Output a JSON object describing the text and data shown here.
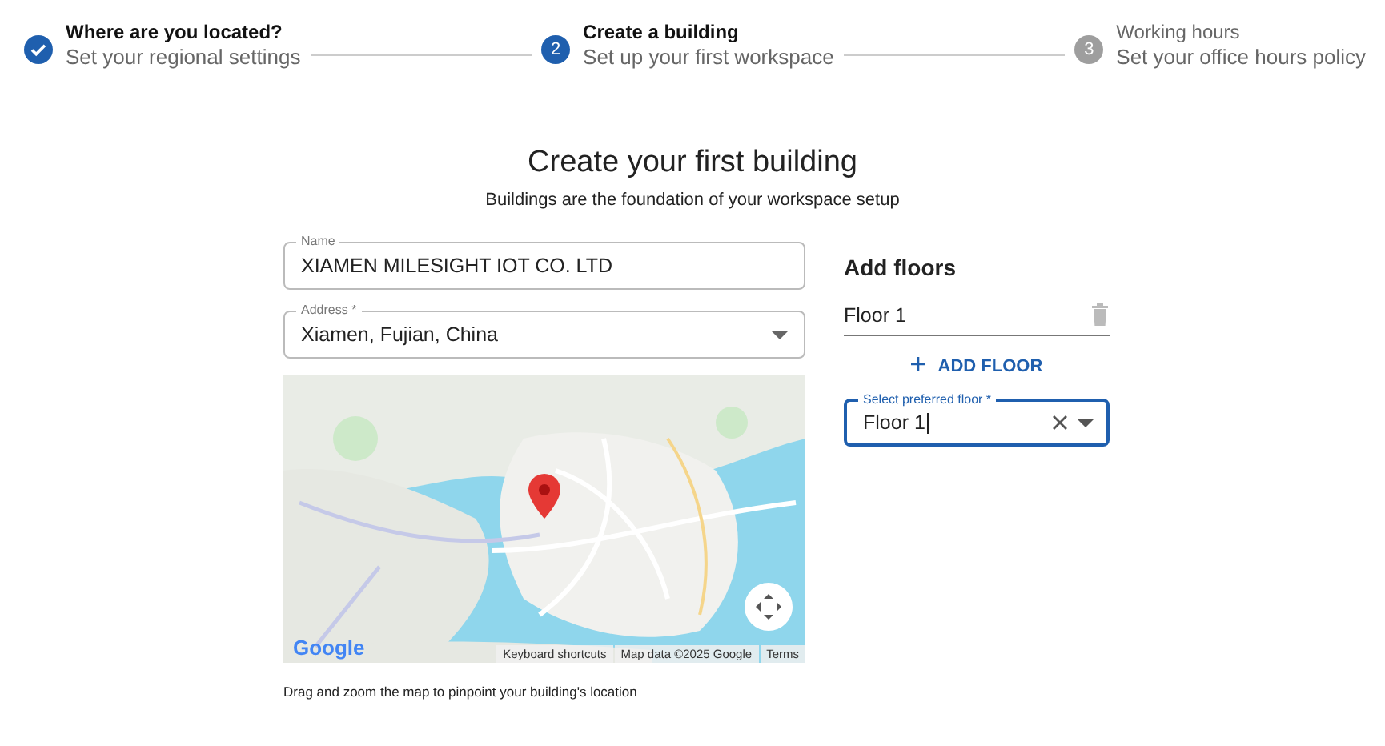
{
  "stepper": [
    {
      "kind": "done",
      "title": "Where are you located?",
      "subtitle": "Set your regional settings"
    },
    {
      "kind": "active",
      "number": "2",
      "title": "Create a building",
      "subtitle": "Set up your first workspace"
    },
    {
      "kind": "upcoming",
      "number": "3",
      "title": "Working hours",
      "subtitle": "Set your office hours policy"
    }
  ],
  "heading": "Create your first building",
  "subheading": "Buildings are the foundation of your workspace setup",
  "name_field": {
    "label": "Name",
    "value": "XIAMEN MILESIGHT IOT CO. LTD"
  },
  "address_field": {
    "label": "Address *",
    "value": "Xiamen, Fujian, China"
  },
  "map": {
    "logo": "Google",
    "attribution": [
      "Keyboard shortcuts",
      "Map data ©2025 Google",
      "Terms"
    ]
  },
  "map_hint": "Drag and zoom the map to pinpoint your building's location",
  "floors": {
    "title": "Add floors",
    "items": [
      {
        "value": "Floor 1"
      }
    ],
    "add_button": "ADD FLOOR"
  },
  "preferred_floor": {
    "label": "Select preferred floor *",
    "value": "Floor 1",
    "focused": true
  }
}
